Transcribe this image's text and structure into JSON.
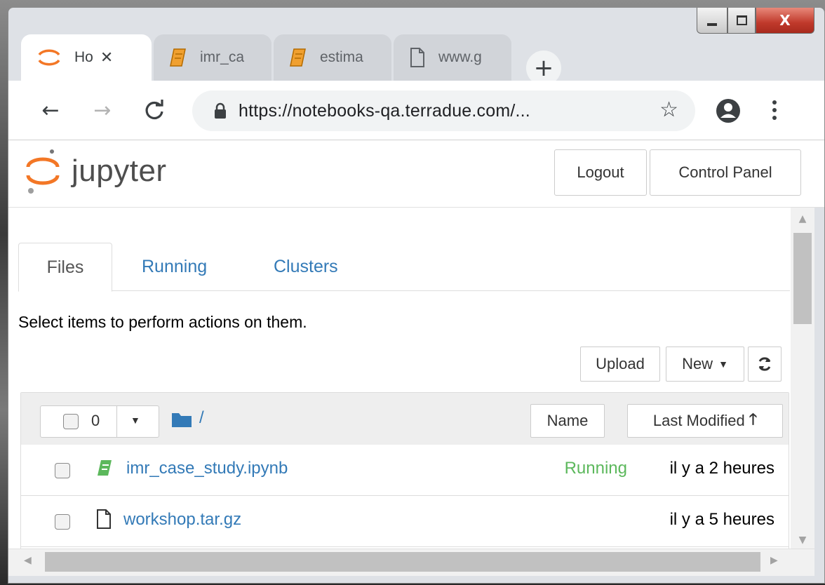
{
  "browser": {
    "tabs": [
      {
        "label": "Ho",
        "icon": "jupyter-logo-icon"
      },
      {
        "label": "imr_ca",
        "icon": "notebook-icon"
      },
      {
        "label": "estima",
        "icon": "notebook-icon"
      },
      {
        "label": "www.g",
        "icon": "page-icon"
      }
    ],
    "close_glyph": "✕",
    "newtab_glyph": "+",
    "url": "https://notebooks-qa.terradue.com/..."
  },
  "header": {
    "logo_text": "jupyter",
    "logout_label": "Logout",
    "control_panel_label": "Control Panel"
  },
  "nav_tabs": [
    "Files",
    "Running",
    "Clusters"
  ],
  "help_text": "Select items to perform actions on them.",
  "actions": {
    "upload_label": "Upload",
    "new_label": "New"
  },
  "list_header": {
    "selected_count": "0",
    "path": "/",
    "name_sort_label": "Name",
    "last_modified_label": "Last Modified"
  },
  "files": [
    {
      "name": "imr_case_study.ipynb",
      "type": "notebook",
      "status": "Running",
      "modified": "il y a 2 heures"
    },
    {
      "name": "workshop.tar.gz",
      "type": "file",
      "status": "",
      "modified": "il y a 5 heures"
    }
  ],
  "colors": {
    "link": "#337ab7",
    "running": "#5cb85c",
    "notebook_icon": "#5cb85c",
    "jupyter_orange": "#f37726",
    "folder": "#337ab7"
  }
}
